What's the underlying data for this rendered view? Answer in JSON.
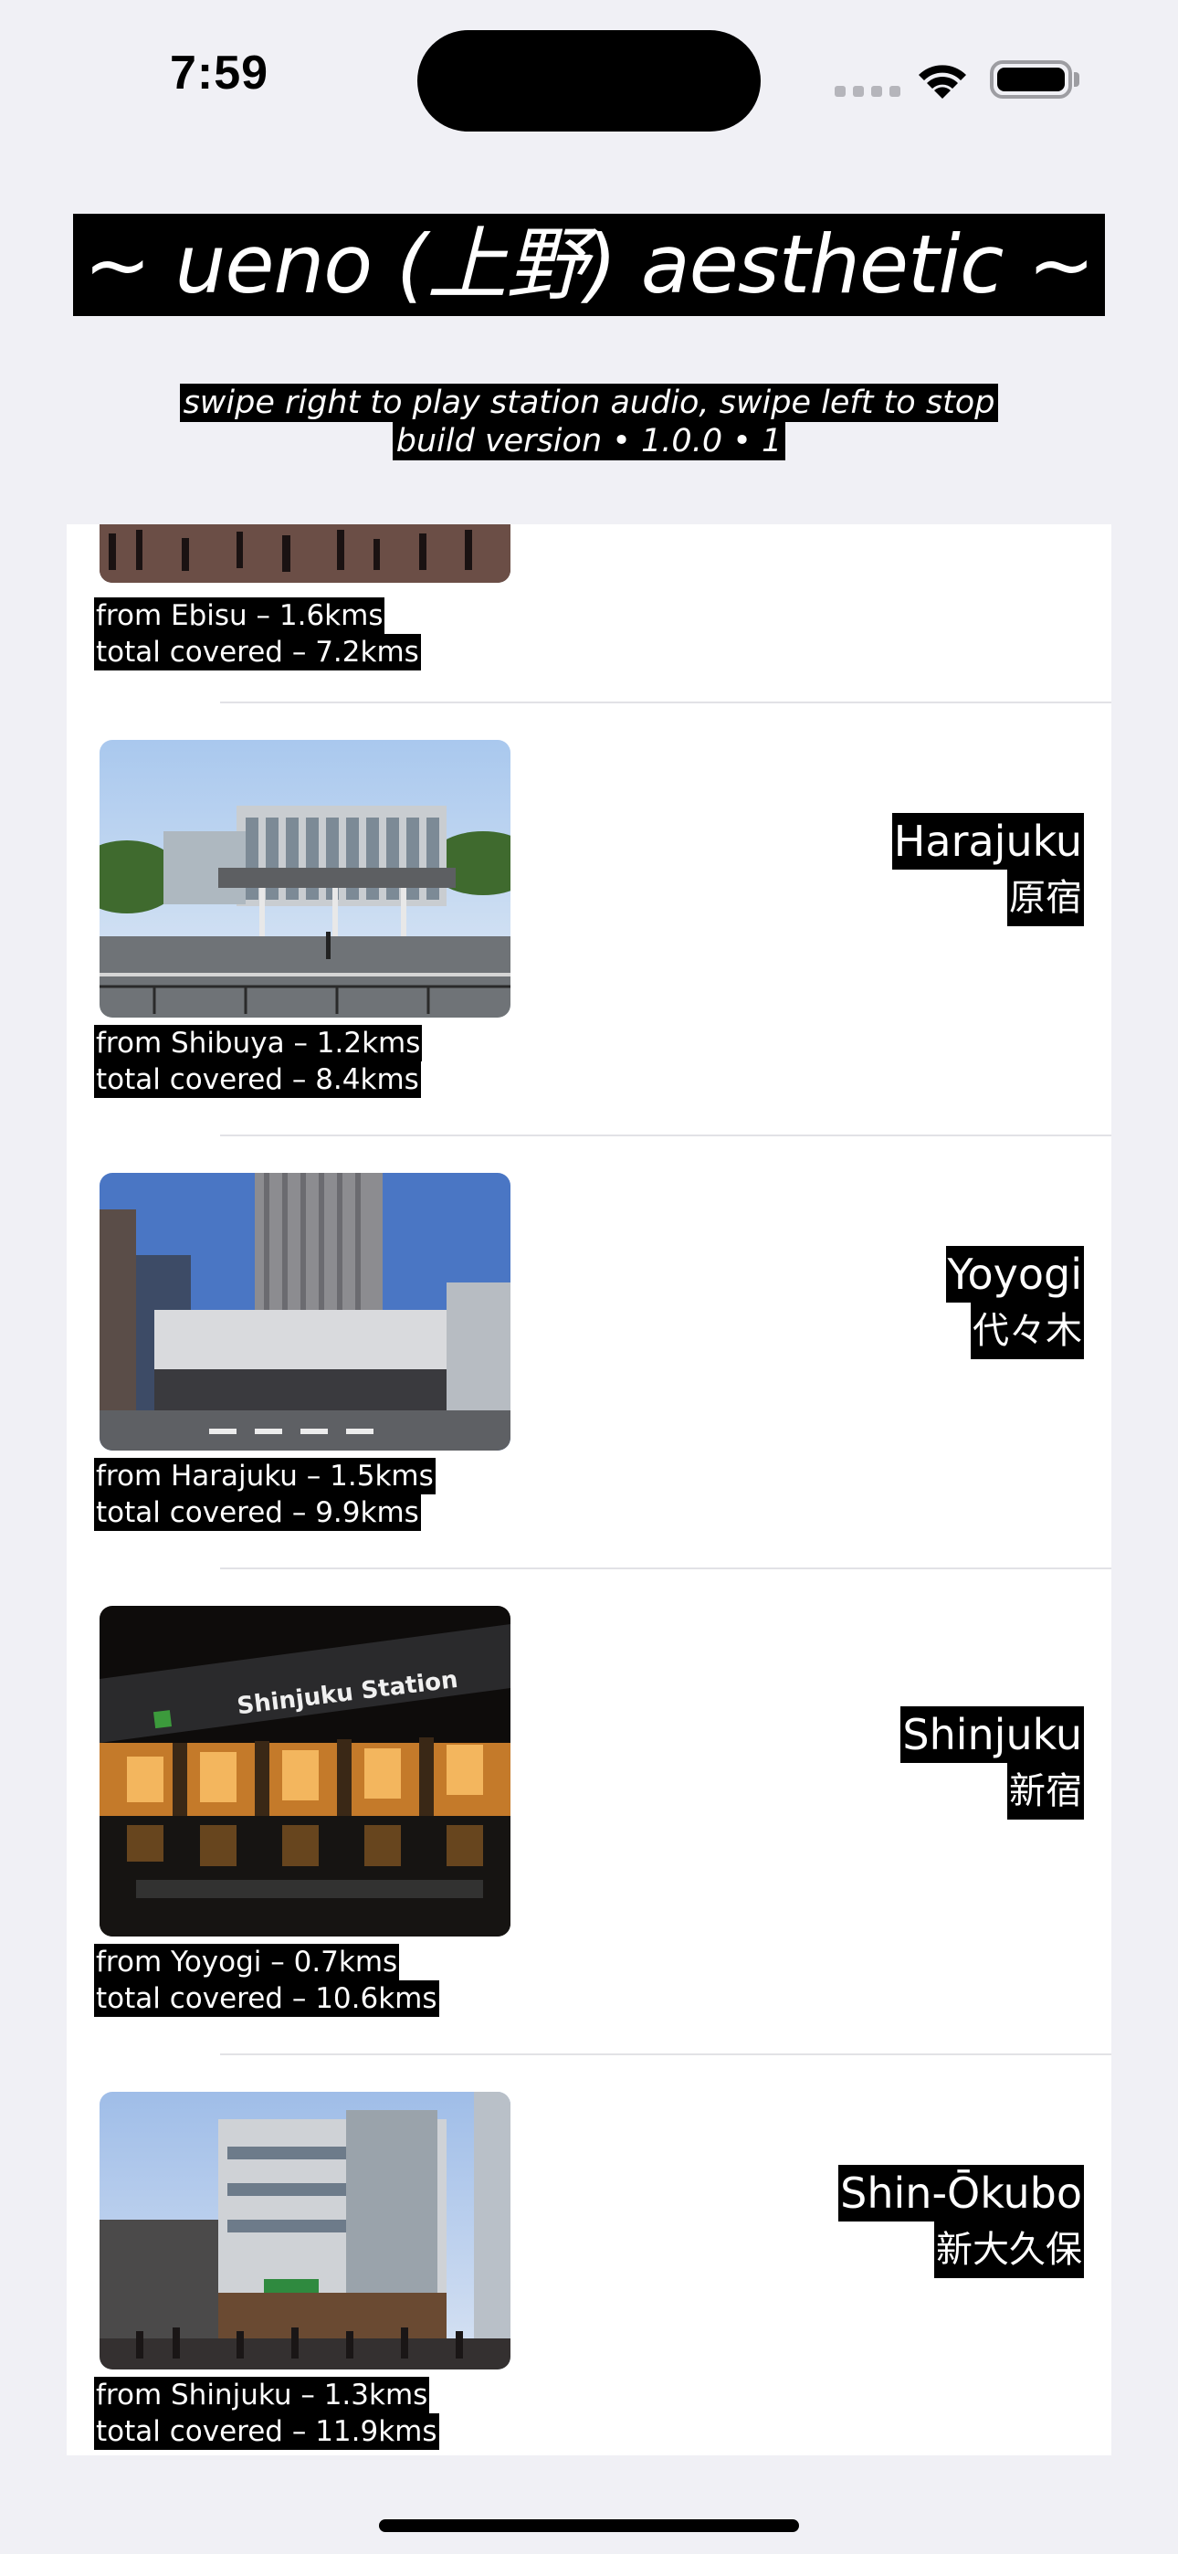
{
  "status_bar": {
    "time": "7:59"
  },
  "header": {
    "title": "~ ueno (上野) aesthetic ~",
    "subtitle_line1": "swipe right to play station audio, swipe left to stop",
    "subtitle_line2": "build version • 1.0.0 • 1"
  },
  "stations": [
    {
      "name_en": "",
      "name_jp": "",
      "from": "from Ebisu – 1.6kms",
      "total": "total covered – 7.2kms"
    },
    {
      "name_en": "Harajuku",
      "name_jp": "原宿",
      "from": "from Shibuya – 1.2kms",
      "total": "total covered – 8.4kms"
    },
    {
      "name_en": "Yoyogi",
      "name_jp": "代々木",
      "from": "from Harajuku – 1.5kms",
      "total": "total covered – 9.9kms"
    },
    {
      "name_en": "Shinjuku",
      "name_jp": "新宿",
      "from": "from Yoyogi – 0.7kms",
      "total": "total covered – 10.6kms",
      "sign_text": "Shinjuku Station"
    },
    {
      "name_en": "Shin-Ōkubo",
      "name_jp": "新大久保",
      "from": "from Shinjuku – 1.3kms",
      "total": "total covered – 11.9kms"
    }
  ]
}
